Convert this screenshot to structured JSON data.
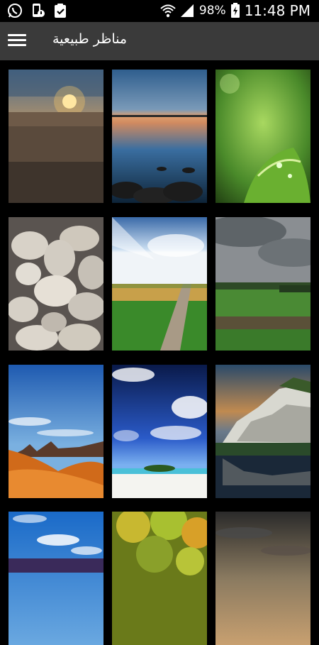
{
  "status_bar": {
    "battery": "98%",
    "time": "11:48 PM",
    "icons": [
      "whatsapp-icon",
      "phone-alert-icon",
      "clipboard-check-icon",
      "wifi-icon",
      "signal-icon",
      "battery-charging-icon"
    ]
  },
  "app_bar": {
    "menu_icon": "hamburger-menu-icon",
    "title": "مناظر طبيعية"
  },
  "wallpapers": [
    {
      "scene": "sunset-beach"
    },
    {
      "scene": "calm-lake-rocks"
    },
    {
      "scene": "green-leaf-closeup"
    },
    {
      "scene": "white-pebbles"
    },
    {
      "scene": "sunny-country-path"
    },
    {
      "scene": "green-fields-cloudy"
    },
    {
      "scene": "desert-mountains"
    },
    {
      "scene": "tropical-island"
    },
    {
      "scene": "cliffs-reflection"
    },
    {
      "scene": "sky-clouds"
    },
    {
      "scene": "autumn-tree"
    },
    {
      "scene": "dusk-sky"
    }
  ]
}
